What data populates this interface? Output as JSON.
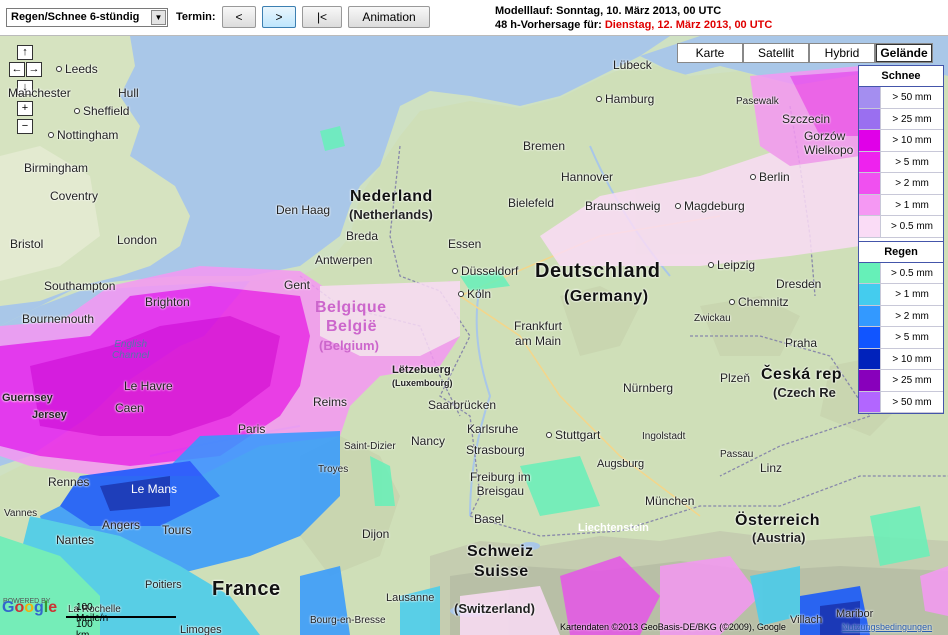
{
  "toolbar": {
    "product": "Regen/Schnee 6-stündig",
    "termin_label": "Termin:",
    "btn_prev": "<",
    "btn_next": ">",
    "btn_first": "|<",
    "btn_animation": "Animation",
    "run_line": "Modelllauf: Sonntag, 10. März 2013, 00 UTC",
    "forecast_prefix": "48 h-Vorhersage für: ",
    "forecast_time": "Dienstag, 12. März 2013, 00 UTC"
  },
  "map_types": [
    {
      "label": "Karte",
      "active": false
    },
    {
      "label": "Satellit",
      "active": false
    },
    {
      "label": "Hybrid",
      "active": false
    },
    {
      "label": "Gelände",
      "active": true
    }
  ],
  "legend": {
    "snow_title": "Schnee",
    "snow": [
      {
        "label": "> 50 mm",
        "color": "#a48ef0"
      },
      {
        "label": "> 25 mm",
        "color": "#9a6ff0"
      },
      {
        "label": "> 10 mm",
        "color": "#e000e8"
      },
      {
        "label": "> 5 mm",
        "color": "#ee22ee"
      },
      {
        "label": "> 2 mm",
        "color": "#f050f0"
      },
      {
        "label": "> 1 mm",
        "color": "#f598f3"
      },
      {
        "label": "> 0.5 mm",
        "color": "#fadcf6"
      }
    ],
    "rain_title": "Regen",
    "rain": [
      {
        "label": "> 0.5 mm",
        "color": "#66f0b8"
      },
      {
        "label": "> 1 mm",
        "color": "#44ccee"
      },
      {
        "label": "> 2 mm",
        "color": "#3399ff"
      },
      {
        "label": "> 5 mm",
        "color": "#1155ff"
      },
      {
        "label": "> 10 mm",
        "color": "#0022bb"
      },
      {
        "label": "> 25 mm",
        "color": "#8800bb"
      },
      {
        "label": "> 50 mm",
        "color": "#b266ff"
      }
    ]
  },
  "cities": {
    "leeds": "Leeds",
    "manchester": "Manchester",
    "hull": "Hull",
    "sheffield": "Sheffield",
    "nottingham": "Nottingham",
    "birmingham": "Birmingham",
    "coventry": "Coventry",
    "bristol": "Bristol",
    "london": "London",
    "southampton": "Southampton",
    "brighton": "Brighton",
    "bournemouth": "Bournemouth",
    "guernsey": "Guernsey",
    "jersey": "Jersey",
    "le_havre": "Le Havre",
    "caen": "Caen",
    "paris": "Paris",
    "rennes": "Rennes",
    "le_mans": "Le Mans",
    "angers": "Angers",
    "tours": "Tours",
    "nantes": "Nantes",
    "vannes": "Vannes",
    "poitiers": "Poitiers",
    "la_rochelle": "La Rochelle",
    "limoges": "Limoges",
    "dijon": "Dijon",
    "troyes": "Troyes",
    "saint_dizier": "Saint-Dizier",
    "reims": "Reims",
    "nancy": "Nancy",
    "strasbourg": "Strasbourg",
    "karlsruhe": "Karlsruhe",
    "stuttgart": "Stuttgart",
    "saarbruecken": "Saarbrücken",
    "freiburg": "Freiburg im\nBreisgau",
    "basel": "Basel",
    "lausanne": "Lausanne",
    "bourg": "Bourg-en-Bresse",
    "den_haag": "Den Haag",
    "breda": "Breda",
    "antwerpen": "Antwerpen",
    "gent": "Gent",
    "essen": "Essen",
    "duesseldorf": "Düsseldorf",
    "koeln": "Köln",
    "frankfurt": "Frankfurt\nam Main",
    "letzebuerg": "Lëtzebuerg",
    "luxembourg": "(Luxembourg)",
    "bielefeld": "Bielefeld",
    "hannover": "Hannover",
    "braunschweig": "Braunschweig",
    "magdeburg": "Magdeburg",
    "bremen": "Bremen",
    "hamburg": "Hamburg",
    "luebeck": "Lübeck",
    "pasewalk": "Pasewalk",
    "szczecin": "Szczecin",
    "gorzow": "Gorzów\nWielkopo",
    "berlin": "Berlin",
    "leipzig": "Leipzig",
    "dresden": "Dresden",
    "chemnitz": "Chemnitz",
    "zwickau": "Zwickau",
    "praha": "Praha",
    "plzen": "Plzeň",
    "nuernberg": "Nürnberg",
    "ingolstadt": "Ingolstadt",
    "augsburg": "Augsburg",
    "muenchen": "München",
    "linz": "Linz",
    "passau": "Passau",
    "maribor": "Maribor",
    "liechtenstein": "Liechtenstein",
    "villach": "Villach"
  },
  "countries": {
    "nederland": "Nederland",
    "netherlands": "(Netherlands)",
    "belgique": "Belgique",
    "belgie": "België",
    "belgium": "(Belgium)",
    "deutschland": "Deutschland",
    "germany": "(Germany)",
    "ceska": "Česká rep",
    "czech": "(Czech Re",
    "oesterreich": "Österreich",
    "austria": "(Austria)",
    "schweiz": "Schweiz",
    "suisse": "Suisse",
    "switzerland": "(Switzerland)",
    "france": "France"
  },
  "water": {
    "channel": "English\nChannel"
  },
  "footer": {
    "powered": "POWERED BY",
    "google": "Google",
    "scale_miles": "100 Meile/n",
    "scale_km": "100 km",
    "copyright": "Kartendaten ©2013 GeoBasis-DE/BKG (©2009), Google",
    "terms": "Nutzungsbedingungen"
  }
}
